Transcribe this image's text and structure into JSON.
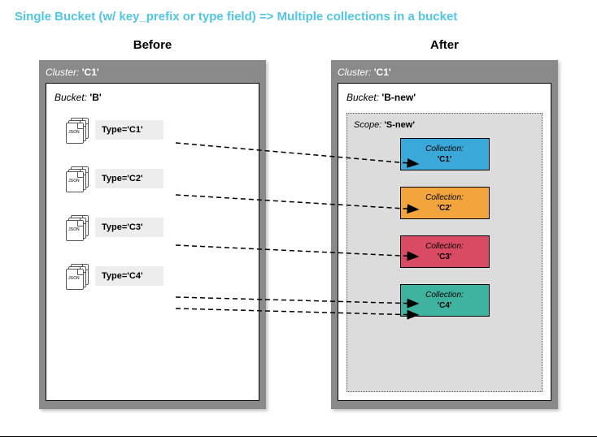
{
  "headline": "Single Bucket (w/ key_prefix or type field)    =>   Multiple collections in a bucket",
  "before": {
    "title": "Before",
    "cluster_prefix": "Cluster: ",
    "cluster_value": "'C1'",
    "bucket_prefix": "Bucket: ",
    "bucket_value": "'B'",
    "rows": [
      "Type='C1'",
      "Type='C2'",
      "Type='C3'",
      "Type='C4'"
    ]
  },
  "after": {
    "title": "After",
    "cluster_prefix": "Cluster: ",
    "cluster_value": "'C1'",
    "bucket_prefix": "Bucket: ",
    "bucket_value": "'B-new'",
    "scope_prefix": "Scope: ",
    "scope_value": "'S-new'",
    "coll_prefix": "Collection:",
    "collections": [
      {
        "value": "'C1'",
        "color": "#3aa8d8"
      },
      {
        "value": "'C2'",
        "color": "#f2a53c"
      },
      {
        "value": "'C3'",
        "color": "#d94a63"
      },
      {
        "value": "'C4'",
        "color": "#3fb39f"
      }
    ]
  },
  "mapping": [
    "C1",
    "C2",
    "C3",
    "C4"
  ]
}
